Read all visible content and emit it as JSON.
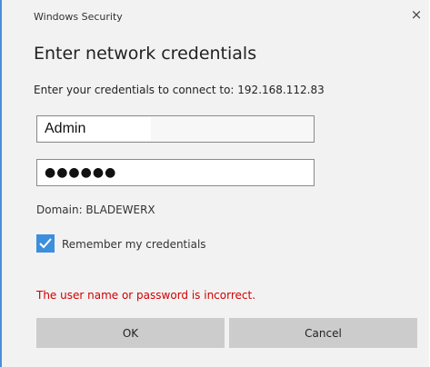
{
  "window": {
    "title": "Windows Security",
    "close_label": "×"
  },
  "dialog": {
    "heading": "Enter network credentials",
    "prompt": "Enter your credentials to connect to: 192.168.112.83"
  },
  "username": {
    "value": "Admin"
  },
  "password": {
    "masked_value": "●●●●●●"
  },
  "domain": {
    "text": "Domain: BLADEWERX"
  },
  "remember": {
    "label": "Remember my credentials",
    "checked": true
  },
  "error": {
    "text": "The user name or password is incorrect.",
    "color": "#d10000"
  },
  "buttons": {
    "ok_label": "OK",
    "cancel_label": "Cancel"
  },
  "colors": {
    "accent": "#3c8fdc",
    "button_bg": "#cccccc",
    "dialog_bg": "#f2f2f2"
  }
}
